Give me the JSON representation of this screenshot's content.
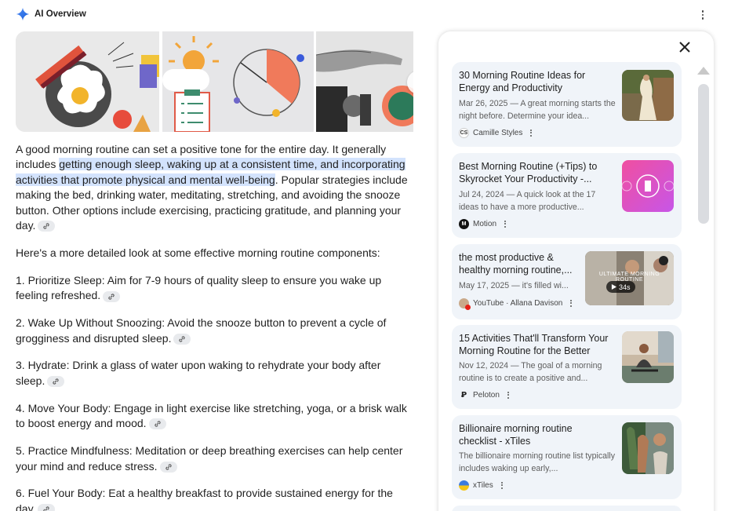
{
  "header": {
    "title": "AI Overview"
  },
  "answer": {
    "intro_before": "A good morning routine can set a positive tone for the entire day. It generally includes ",
    "intro_highlight": "getting enough sleep, waking up at a consistent time, and incorporating activities that promote physical and mental well-being",
    "intro_after": ". Popular strategies include making the bed, drinking water, meditating, stretching, and avoiding the snooze button. Other options include exercising, practicing gratitude, and planning your day.",
    "lead": "Here's a more detailed look at some effective morning routine components:",
    "items": [
      "1. Prioritize Sleep: Aim for 7-9 hours of quality sleep to ensure you wake up feeling refreshed.",
      "2. Wake Up Without Snoozing: Avoid the snooze button to prevent a cycle of grogginess and disrupted sleep.",
      "3. Hydrate: Drink a glass of water upon waking to rehydrate your body after sleep.",
      "4. Move Your Body: Engage in light exercise like stretching, yoga, or a brisk walk to boost energy and mood.",
      "5. Practice Mindfulness: Meditation or deep breathing exercises can help center your mind and reduce stress.",
      "6. Fuel Your Body: Eat a healthy breakfast to provide sustained energy for the day."
    ]
  },
  "sources": [
    {
      "title": "30 Morning Routine Ideas for Energy and Productivity",
      "snippet": "Mar 26, 2025 — A great morning starts the night before. Determine your idea...",
      "source": "Camille Styles",
      "favicon": "CS"
    },
    {
      "title": "Best Morning Routine (+Tips) to Skyrocket Your Productivity -...",
      "snippet": "Jul 24, 2024 — A quick look at the 17 ideas to have a more productive...",
      "source": "Motion",
      "favicon": "M"
    },
    {
      "title": "the most productive & healthy morning routine,...",
      "snippet": "May 17, 2025 — it's filled wi...",
      "source": "YouTube · Allana Davison",
      "favicon": "",
      "video_duration": "34s",
      "video_overlay": "ULTIMATE MORNING ROUTINE"
    },
    {
      "title": "15 Activities That'll Transform Your Morning Routine for the Better",
      "snippet": "Nov 12, 2024 — The goal of a morning routine is to create a positive and...",
      "source": "Peloton",
      "favicon": "P"
    },
    {
      "title": "Billionaire morning routine checklist - xTiles",
      "snippet": "The billionaire morning routine list typically includes waking up early,...",
      "source": "xTiles",
      "favicon": ""
    }
  ],
  "colors": {
    "highlight": "#d3e3fd",
    "card_bg": "#f0f4f9",
    "gemini_blue": "#4285f4"
  }
}
